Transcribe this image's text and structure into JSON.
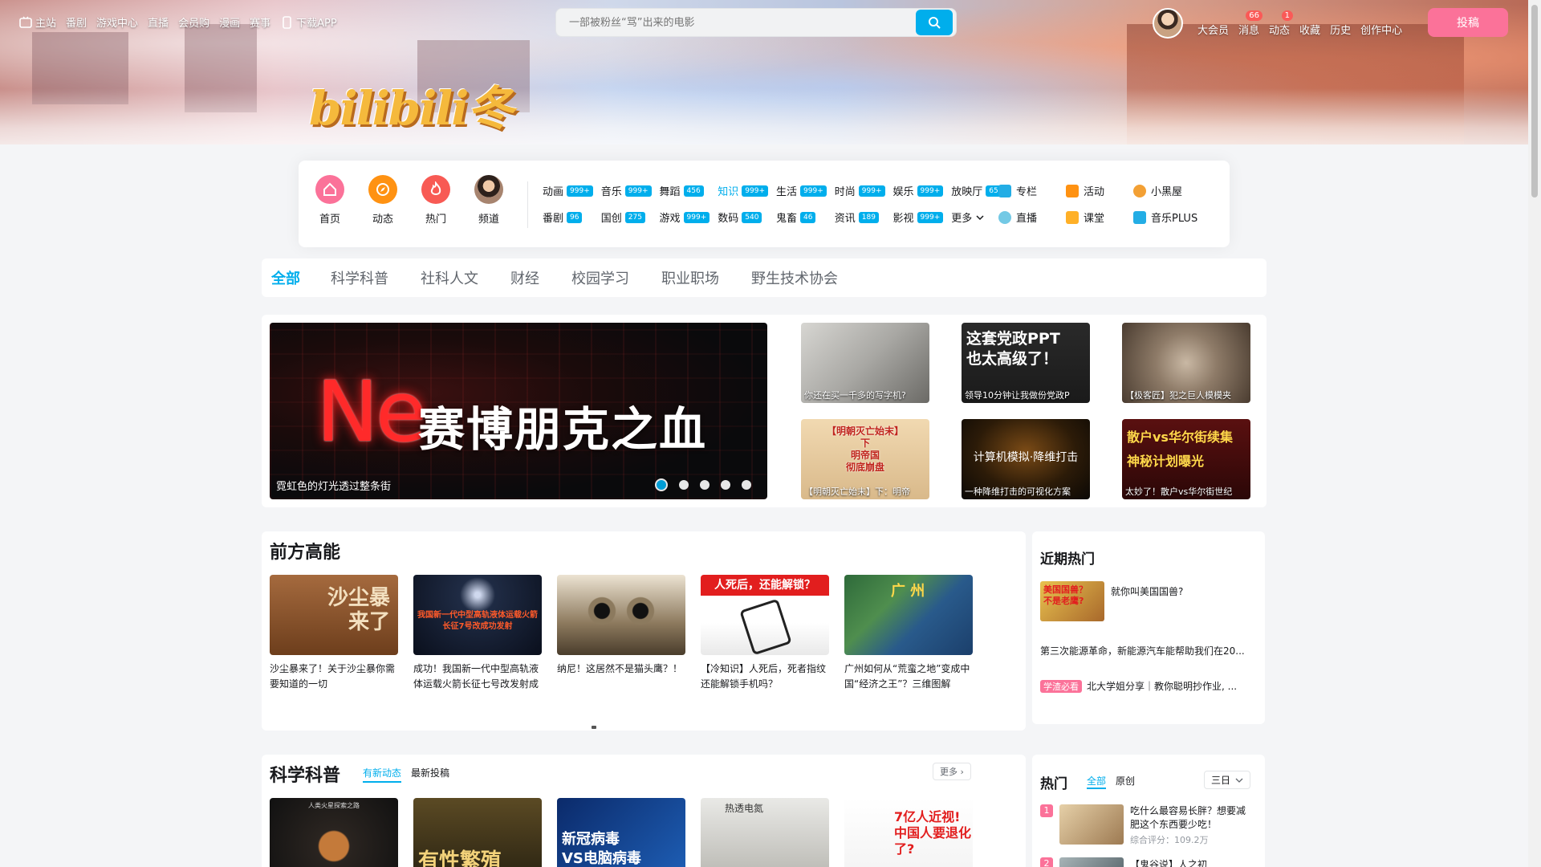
{
  "nav": {
    "links": [
      "主站",
      "番剧",
      "游戏中心",
      "直播",
      "会员购",
      "漫画",
      "赛事",
      "下载APP"
    ],
    "search_placeholder": "一部被粉丝“骂”出来的电影",
    "right_links": [
      "大会员",
      "消息",
      "动态",
      "收藏",
      "历史",
      "创作中心"
    ],
    "msg_badge": "66",
    "dyn_badge": "1",
    "upload": "投稿"
  },
  "banner_logo": "bilibili冬",
  "channels": {
    "main": [
      {
        "label": "首页",
        "color": "#fb7299",
        "icon": "home-icon"
      },
      {
        "label": "动态",
        "color": "#ff9212",
        "icon": "compass-icon"
      },
      {
        "label": "热门",
        "color": "#f85a54",
        "icon": "fire-icon"
      },
      {
        "label": "频道",
        "color": "#8b6f64",
        "icon": "channel-avatar-icon"
      }
    ],
    "cats": [
      {
        "label": "动画",
        "count": "999+"
      },
      {
        "label": "音乐",
        "count": "999+"
      },
      {
        "label": "舞蹈",
        "count": "456"
      },
      {
        "label": "知识",
        "count": "999+"
      },
      {
        "label": "生活",
        "count": "999+"
      },
      {
        "label": "时尚",
        "count": "999+"
      },
      {
        "label": "娱乐",
        "count": "999+"
      },
      {
        "label": "放映厅",
        "count": "65"
      },
      {
        "label": "番剧",
        "count": "96"
      },
      {
        "label": "国创",
        "count": "275"
      },
      {
        "label": "游戏",
        "count": "999+"
      },
      {
        "label": "数码",
        "count": "540"
      },
      {
        "label": "鬼畜",
        "count": "46"
      },
      {
        "label": "资讯",
        "count": "189"
      },
      {
        "label": "影视",
        "count": "999+"
      },
      {
        "label": "更多",
        "count": ""
      }
    ],
    "extras": [
      {
        "label": "专栏",
        "color": "#23ade5"
      },
      {
        "label": "活动",
        "color": "#ff9212"
      },
      {
        "label": "小黑屋",
        "color": "#f3a034"
      },
      {
        "label": "直播",
        "color": "#73c9e5"
      },
      {
        "label": "课堂",
        "color": "#ffb027"
      },
      {
        "label": "音乐PLUS",
        "color": "#23ade5"
      }
    ]
  },
  "tabs": [
    "全部",
    "科学科普",
    "社科人文",
    "财经",
    "校园学习",
    "职业职场",
    "野生技术协会"
  ],
  "carousel": {
    "ne": "Ne",
    "title": "赛博朋克之血",
    "caption": "霓虹色的灯光透过整条街"
  },
  "featured": [
    {
      "title": "你还在买一千多的写字机?",
      "big": ""
    },
    {
      "title": "领导10分钟让我做份党政P",
      "big": "这套党政PPT\n也太高级了！"
    },
    {
      "title": "【极客匠】犯之巨人模模夹",
      "big": ""
    },
    {
      "title": "【明朝灭亡始末】下：明帝",
      "big": "【明朝灭亡始末】\n下\n明帝国\n彻底崩盘"
    },
    {
      "title": "一种降维打击的可视化方案",
      "big": "计算机模拟·降维打击"
    },
    {
      "title": "太妙了！散户vs华尔街世纪",
      "big": "散户vs华尔街续集\n神秘计划曝光"
    }
  ],
  "qianfang": {
    "title": "前方高能",
    "cards": [
      {
        "title": "沙尘暴来了！关于沙尘暴你需要知道的一切",
        "overlay": "沙尘暴\n来了"
      },
      {
        "title": "成功！我国新一代中型高轨液体运载火箭长征七号改发射成",
        "overlay": "我国新一代中型高轨液体运载火箭\n长征7号改成功发射"
      },
      {
        "title": "纳尼！这居然不是猫头鹰？！",
        "overlay": ""
      },
      {
        "title": "【冷知识】人死后，死者指纹还能解锁手机吗？",
        "overlay": "人死后，还能解锁？"
      },
      {
        "title": "广州如何从“荒蛮之地”变成中国“经济之王”？三维图解",
        "overlay": "广 州"
      }
    ]
  },
  "recent_hot": {
    "title": "近期热门",
    "items": [
      {
        "text": "就你叫美国国兽?",
        "thumb": "美国国兽？\n不是老鹰?"
      },
      {
        "text": "第三次能源革命，新能源汽车能帮助我们在20..."
      },
      {
        "tag": "学渣必看",
        "text": "北大学姐分享｜教你聪明抄作业, ..."
      }
    ]
  },
  "science": {
    "title": "科学科普",
    "sub_tabs": [
      "有新动态",
      "最新投稿"
    ],
    "more": "更多",
    "cards": [
      {
        "overlay": "人类火星探索之路"
      },
      {
        "overlay": "有性繁殖"
      },
      {
        "overlay": "新冠病毒\nVS电脑病毒"
      },
      {
        "overlay": "热透电氮"
      },
      {
        "overlay": "7亿人近视!\n中国人要退化了?"
      }
    ]
  },
  "hot_side": {
    "title": "热门",
    "tabs": [
      "全部",
      "原创"
    ],
    "range": "三日",
    "items": [
      {
        "rank": "1",
        "title": "吃什么最容易长胖？想要减肥这个东西要少吃！",
        "score": "综合评分：109.2万"
      },
      {
        "rank": "2",
        "title": "【鬼谷说】人之初"
      }
    ]
  }
}
